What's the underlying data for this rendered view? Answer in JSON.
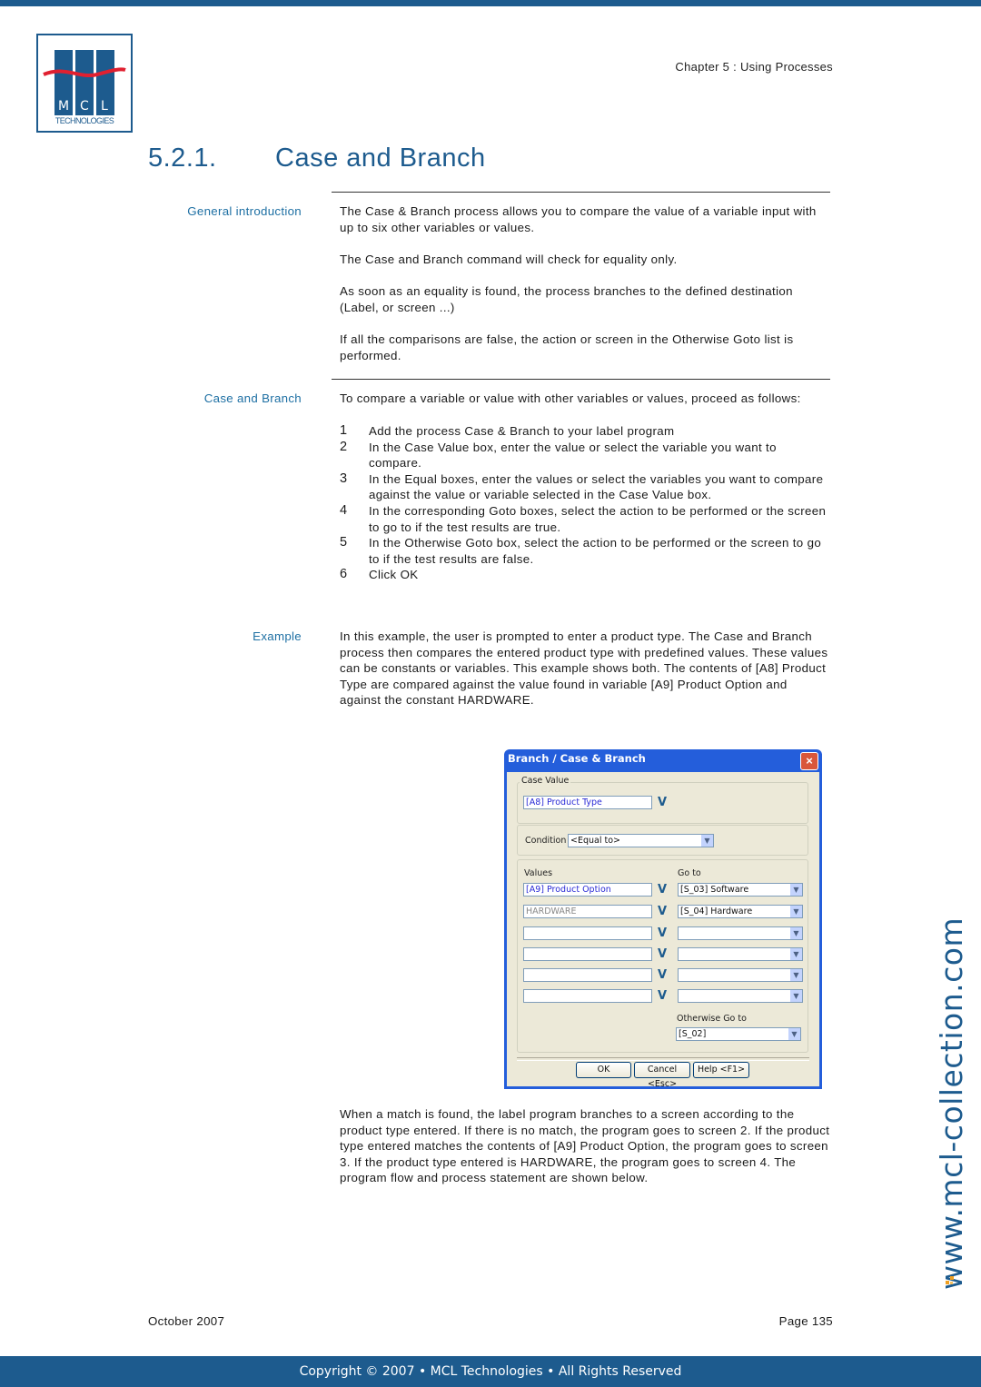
{
  "header": {
    "logo_text_top": "M C L",
    "logo_text_bottom": "TECHNOLOGIES",
    "chapter": "Chapter 5 : Using Processes",
    "section_number": "5.2.1.",
    "section_title": "Case and Branch"
  },
  "sections": [
    {
      "label": "General introduction",
      "paragraphs": [
        "The Case & Branch process allows you to compare the value of a variable input with up to six other variables or values.",
        "The Case and Branch command will check for equality only.",
        "As soon as an equality is found, the process branches to the defined destination (Label, or screen ...)",
        "If all the comparisons are false, the action or screen in the Otherwise Goto list is performed."
      ]
    },
    {
      "label": "Case and Branch",
      "intro": "To compare a variable or value with other variables or values, proceed as follows:",
      "steps": [
        {
          "n": "1",
          "text": "Add the process Case & Branch to your label program"
        },
        {
          "n": "2",
          "text": "In the Case Value box, enter the value or select the variable you want to compare."
        },
        {
          "n": "3",
          "text": "In the Equal boxes, enter the values or select the variables you want to compare against the value or variable selected in the Case Value box."
        },
        {
          "n": "4",
          "text": "In the corresponding Goto boxes, select the action to be performed or the screen to go to if the test results are true."
        },
        {
          "n": "5",
          "text": "In the Otherwise Goto box, select the action to be performed or the screen to go to if the test results are false."
        },
        {
          "n": "6",
          "text": "Click OK"
        }
      ]
    },
    {
      "label": "Example",
      "paragraphs": [
        "In this example, the user is prompted to enter a product type. The Case and Branch process then compares the entered product type with predefined values. These values can be constants or variables. This example shows both. The contents of [A8] Product Type are compared against the value found in variable [A9] Product Option and against the constant HARDWARE."
      ],
      "after": "When a match is found, the label program branches to a screen according to the product type entered. If there is no match, the program goes to screen 2. If the product type entered matches the contents of [A9] Product Option, the program goes to screen 3. If the product type entered is HARDWARE, the program goes to screen 4. The program flow and process statement are shown below."
    }
  ],
  "dialog": {
    "title": "Branch / Case & Branch",
    "close_icon": "×",
    "case_value_label": "Case Value",
    "case_value": "[A8] Product Type",
    "variable_button": "V",
    "condition_label": "Condition",
    "condition_value": "<Equal to>",
    "values_label": "Values",
    "goto_label": "Go to",
    "rows": [
      {
        "value": "[A9] Product Option",
        "goto": "[S_03] Software"
      },
      {
        "value": "HARDWARE",
        "goto": "[S_04] Hardware"
      },
      {
        "value": "",
        "goto": ""
      },
      {
        "value": "",
        "goto": ""
      },
      {
        "value": "",
        "goto": ""
      },
      {
        "value": "",
        "goto": ""
      }
    ],
    "otherwise_label": "Otherwise Go to",
    "otherwise_value": "[S_02]",
    "ok_label": "OK",
    "cancel_label": "Cancel <Esc>",
    "help_label": "Help <F1>"
  },
  "watermark": "www.mcl-collection.com",
  "footer": {
    "date": "October 2007",
    "page": "Page 135",
    "copyright": "Copyright © 2007 • MCL Technologies • All Rights Reserved"
  },
  "colors": {
    "brand_blue": "#1d5b8e",
    "label_blue": "#1d6fa3",
    "logo_red": "#e02030",
    "watermark_orange": "#f0a020"
  }
}
